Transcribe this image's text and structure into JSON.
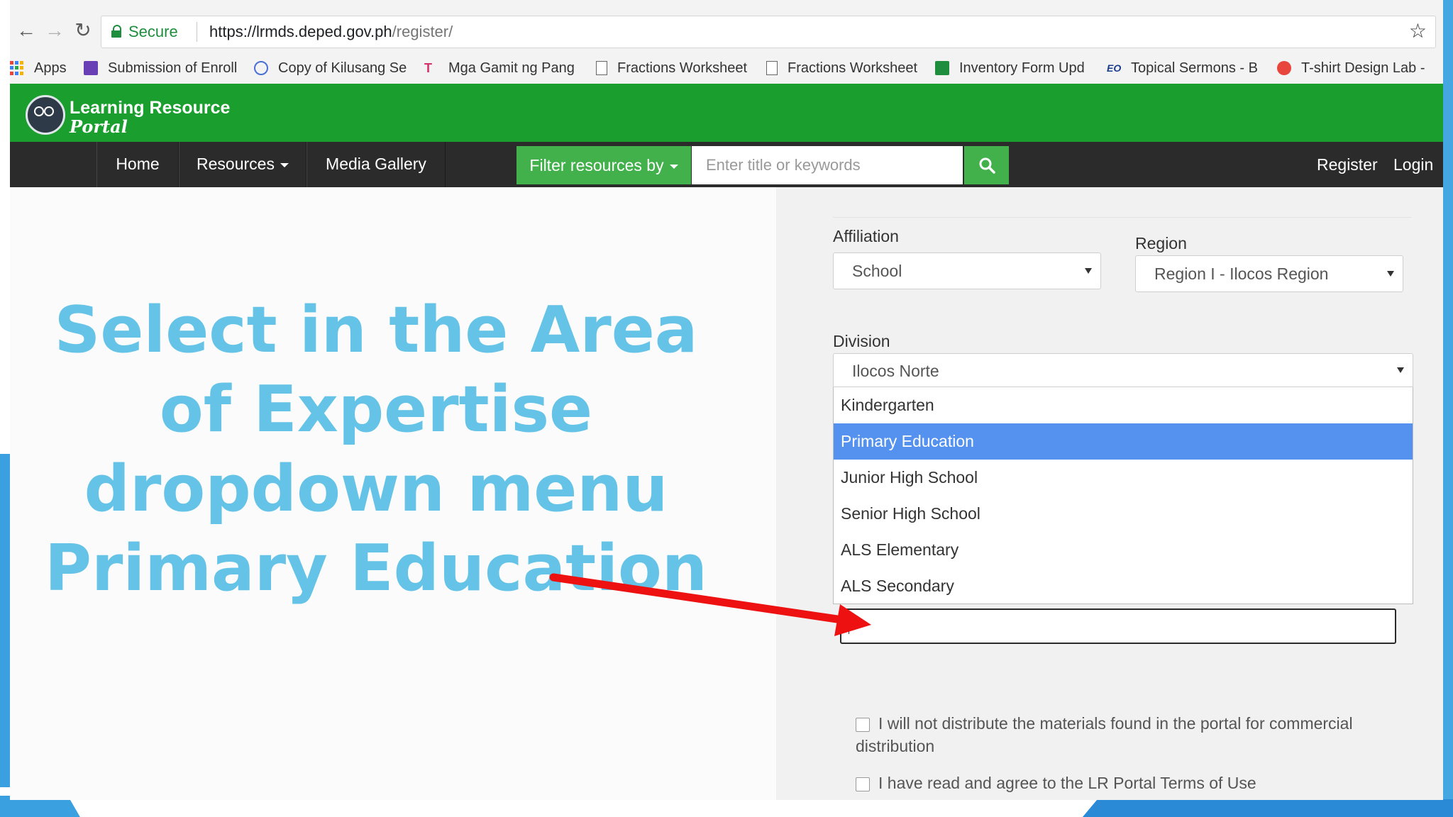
{
  "browser": {
    "secure_label": "Secure",
    "url_host": "https://lrmds.deped.gov.ph",
    "url_path": "/register/",
    "bookmarks": [
      {
        "label": "Apps",
        "icon": "apps-grid-icon"
      },
      {
        "label": "Submission of Enroll",
        "icon": "forms-icon",
        "color": "#6a3fb5"
      },
      {
        "label": "Copy of Kilusang Se",
        "icon": "globe-icon",
        "color": "#4a6fd6"
      },
      {
        "label": "Mga Gamit ng Pang",
        "icon": "tl-icon",
        "color": "#d6336c"
      },
      {
        "label": "Fractions Worksheet",
        "icon": "page-icon"
      },
      {
        "label": "Fractions Worksheet",
        "icon": "page-icon"
      },
      {
        "label": "Inventory Form Upd",
        "icon": "sheets-icon",
        "color": "#1e8e3e"
      },
      {
        "label": "Topical Sermons - B",
        "icon": "eo-icon",
        "color": "#1a3a8a"
      },
      {
        "label": "T-shirt Design Lab -",
        "icon": "gear-flower-icon",
        "color": "#e8453c"
      }
    ]
  },
  "site": {
    "logo_line1": "Learning Resource",
    "logo_line2": "Portal",
    "nav": {
      "home": "Home",
      "resources": "Resources",
      "media_gallery": "Media Gallery",
      "filter": "Filter resources by",
      "search_placeholder": "Enter title or keywords",
      "register": "Register",
      "login": "Login"
    },
    "colors": {
      "header_green": "#1a9e2e",
      "button_green": "#43b14b",
      "nav_dark": "#2b2b2b",
      "selected_blue": "#5592f0"
    }
  },
  "form": {
    "affiliation_label": "Affiliation",
    "affiliation_value": "School",
    "region_label": "Region",
    "region_value": "Region I - Ilocos Region",
    "division_label": "Division",
    "division_value": "Ilocos Norte",
    "dropdown_options": [
      "Kindergarten",
      "Primary Education",
      "Junior High School",
      "Senior High School",
      "ALS Elementary",
      "ALS Secondary"
    ],
    "selected_option": "Primary Education",
    "checkbox_1": "I will not distribute the materials found in the portal for commercial distribution",
    "checkbox_2": "I have read and agree to the LR Portal Terms of Use"
  },
  "annotation": {
    "instruction": "Select in the Area of Expertise dropdown menu Primary Education",
    "text_color": "#64c3e6",
    "arrow_color": "#ee1111"
  }
}
